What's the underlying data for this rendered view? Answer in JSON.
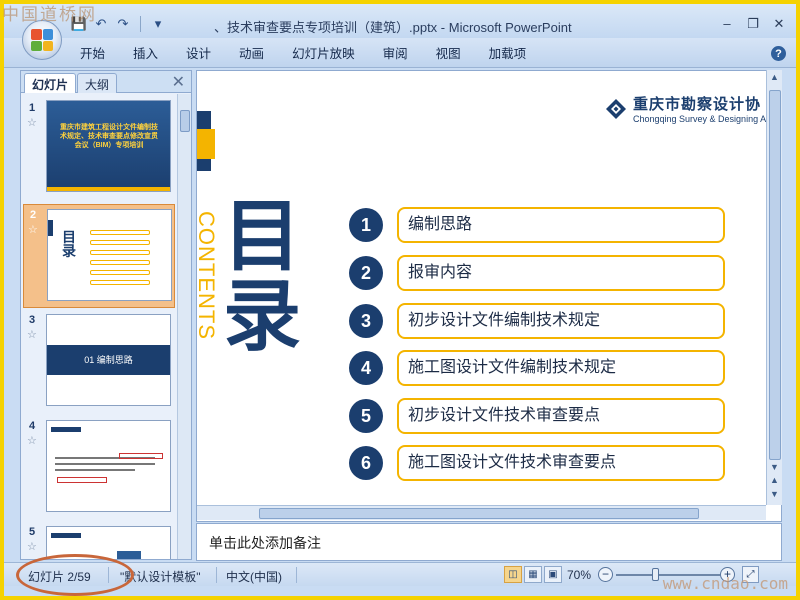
{
  "app": {
    "window_title": "、技术审查要点专项培训（建筑）.pptx - Microsoft PowerPoint"
  },
  "quick_access": {
    "icons": [
      "save-icon",
      "undo-icon",
      "redo-icon",
      "customize-icon"
    ]
  },
  "ribbon": {
    "tabs": [
      "开始",
      "插入",
      "设计",
      "动画",
      "幻灯片放映",
      "审阅",
      "视图",
      "加载项"
    ]
  },
  "panel": {
    "tab_slides": "幻灯片",
    "tab_outline": "大纲",
    "thumbnails": [
      {
        "num": "1",
        "star": "☆",
        "title": "重庆市建筑工程设计文件编制技术规定、技术审查要点修改宣贯会议（BIM）专项培训"
      },
      {
        "num": "2",
        "star": "☆",
        "title": "目录"
      },
      {
        "num": "3",
        "star": "☆",
        "title": "01  编制思路"
      },
      {
        "num": "4",
        "star": "☆",
        "title": ""
      },
      {
        "num": "5",
        "star": "☆",
        "title": ""
      }
    ]
  },
  "slide": {
    "company_name_cn": "重庆市勘察设计协",
    "company_name_en": "Chongqing Survey & Designing Asso",
    "contents_word": "CONTENTS",
    "heading": "目录",
    "toc": [
      {
        "num": "1",
        "label": "编制思路"
      },
      {
        "num": "2",
        "label": "报审内容"
      },
      {
        "num": "3",
        "label": "初步设计文件编制技术规定"
      },
      {
        "num": "4",
        "label": "施工图设计文件编制技术规定"
      },
      {
        "num": "5",
        "label": "初步设计文件技术审查要点"
      },
      {
        "num": "6",
        "label": "施工图设计文件技术审查要点"
      }
    ]
  },
  "notes": {
    "placeholder": "单击此处添加备注"
  },
  "status": {
    "slide_counter": "幻灯片 2/59",
    "template": "\"默认设计模板\"",
    "language": "中文(中国)",
    "zoom": "70%"
  },
  "watermarks": {
    "top": "中国道桥网",
    "bottom": "www.cndao.com"
  },
  "colors": {
    "navy": "#1b3e6e",
    "gold": "#f4b400",
    "frame": "#f5d200"
  }
}
